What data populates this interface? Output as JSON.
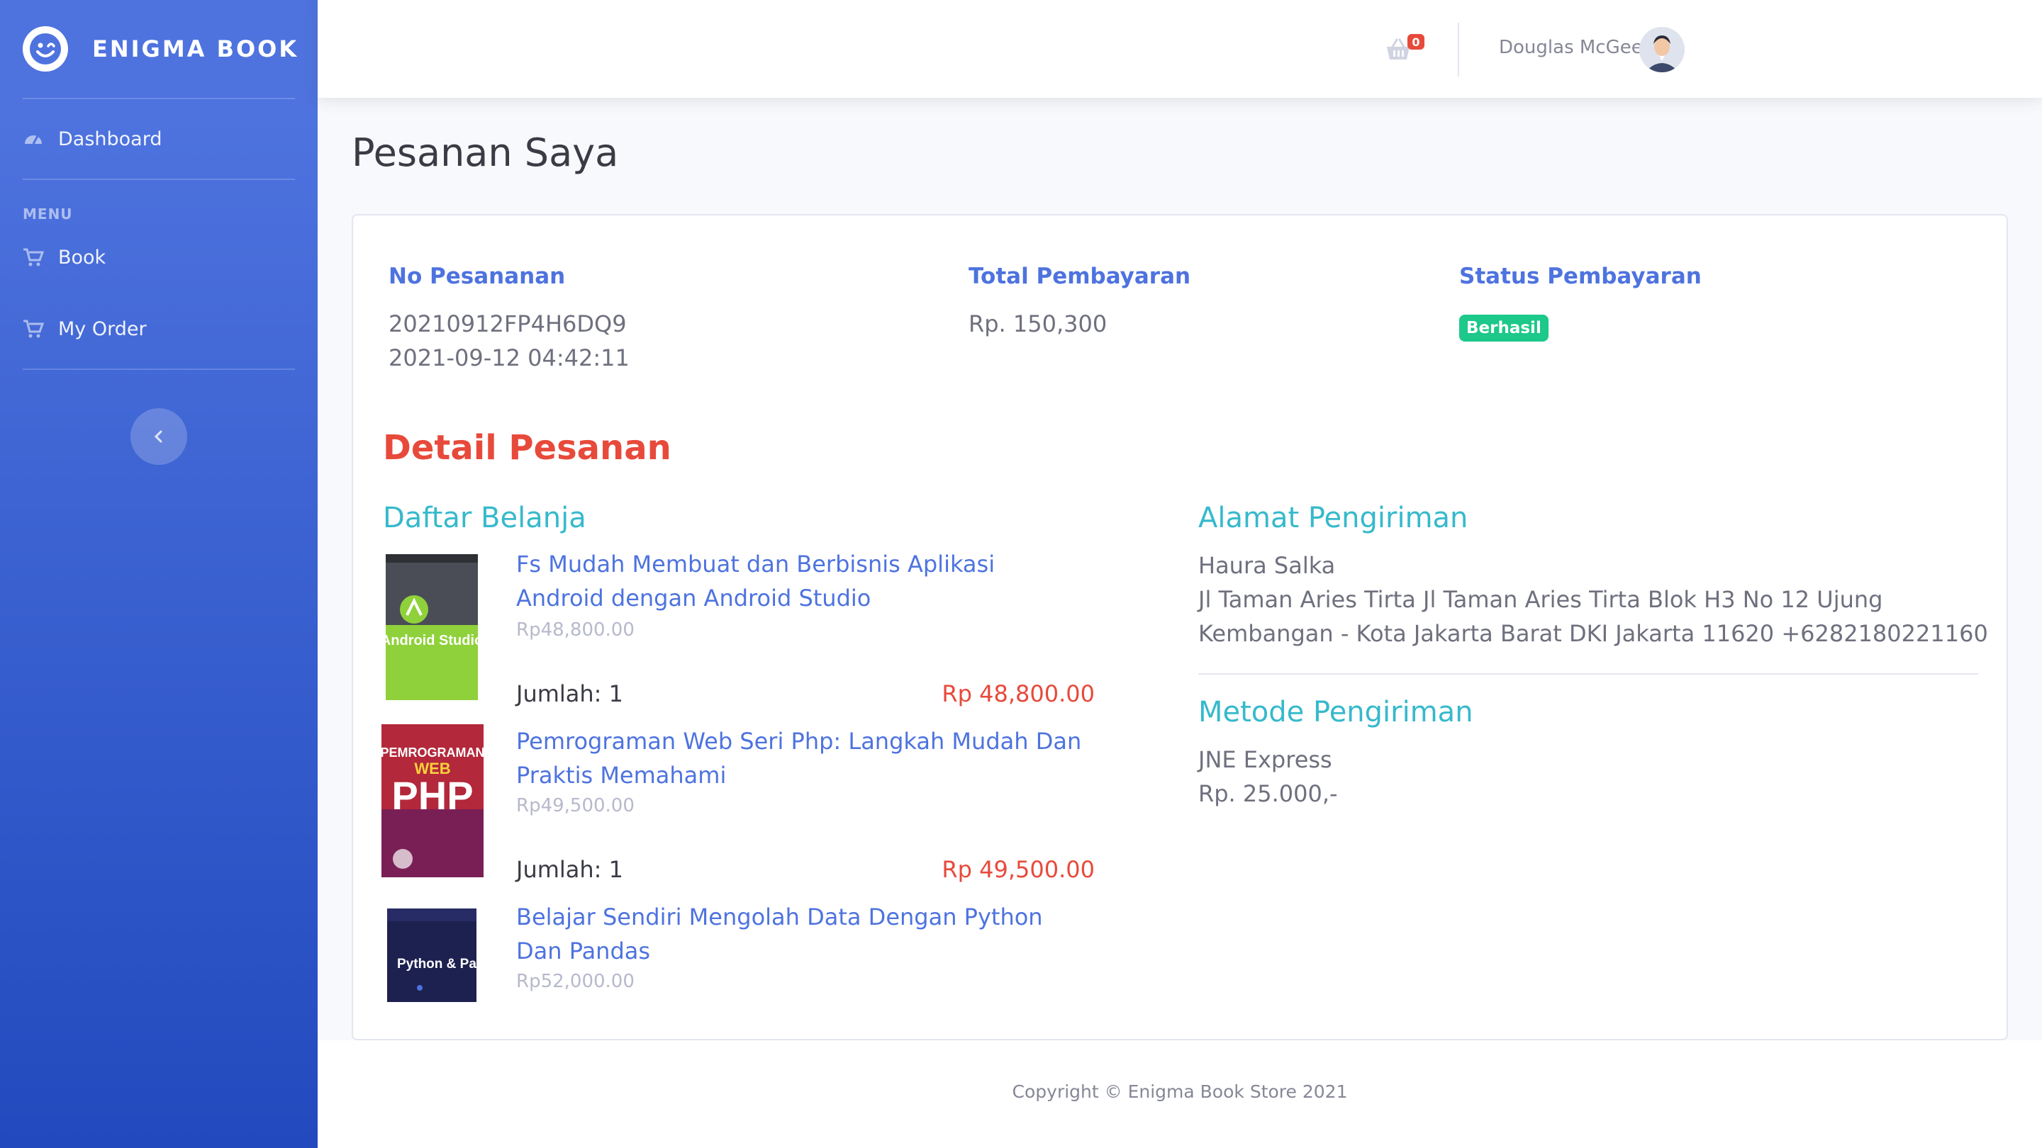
{
  "brand": {
    "name": "ENIGMA BOOK",
    "logo_icon": "smile-wink-icon"
  },
  "sidebar": {
    "dashboard_label": "Dashboard",
    "menu_heading": "MENU",
    "items": [
      {
        "label": "Book",
        "icon": "cart-icon"
      },
      {
        "label": "My Order",
        "icon": "cart-icon"
      }
    ],
    "toggle_icon": "chevron-left-icon"
  },
  "topbar": {
    "cart_count": "0",
    "user_name": "Douglas McGee"
  },
  "page": {
    "title": "Pesanan Saya"
  },
  "order": {
    "no_label": "No Pesananan",
    "no_value": "20210912FP4H6DQ9",
    "date": "2021-09-12 04:42:11",
    "total_label": "Total Pembayaran",
    "total_value": "Rp. 150,300",
    "status_label": "Status Pembayaran",
    "status_value": "Berhasil"
  },
  "detail": {
    "title": "Detail Pesanan",
    "cart_title": "Daftar Belanja",
    "items": [
      {
        "title": "Fs Mudah Membuat dan Berbisnis Aplikasi Android dengan Android Studio",
        "price": "Rp48,800.00",
        "qty": "Jumlah: 1",
        "subtotal": "Rp 48,800.00",
        "cover_text": "Android Studio"
      },
      {
        "title": "Pemrograman Web Seri Php: Langkah Mudah Dan Praktis Memahami",
        "price": "Rp49,500.00",
        "qty": "Jumlah: 1",
        "subtotal": "Rp 49,500.00",
        "cover_text": "PHP"
      },
      {
        "title": "Belajar Sendiri Mengolah Data Dengan Python Dan Pandas",
        "price": "Rp52,000.00",
        "cover_text": "Python & Pandas"
      }
    ],
    "address_title": "Alamat Pengiriman",
    "recipient": "Haura Salka",
    "address": "Jl Taman Aries Tirta Jl Taman Aries Tirta Blok H3 No 12 Ujung Kembangan - Kota Jakarta Barat DKI Jakarta 11620 +6282180221160",
    "shipping_title": "Metode Pengiriman",
    "courier": "JNE Express",
    "shipping_cost": "Rp. 25.000,-"
  },
  "footer": {
    "copyright": "Copyright © Enigma Book Store 2021"
  },
  "colors": {
    "primary": "#4e73df",
    "danger": "#e74a3b",
    "info": "#36b9cc",
    "success": "#1cc88a"
  }
}
